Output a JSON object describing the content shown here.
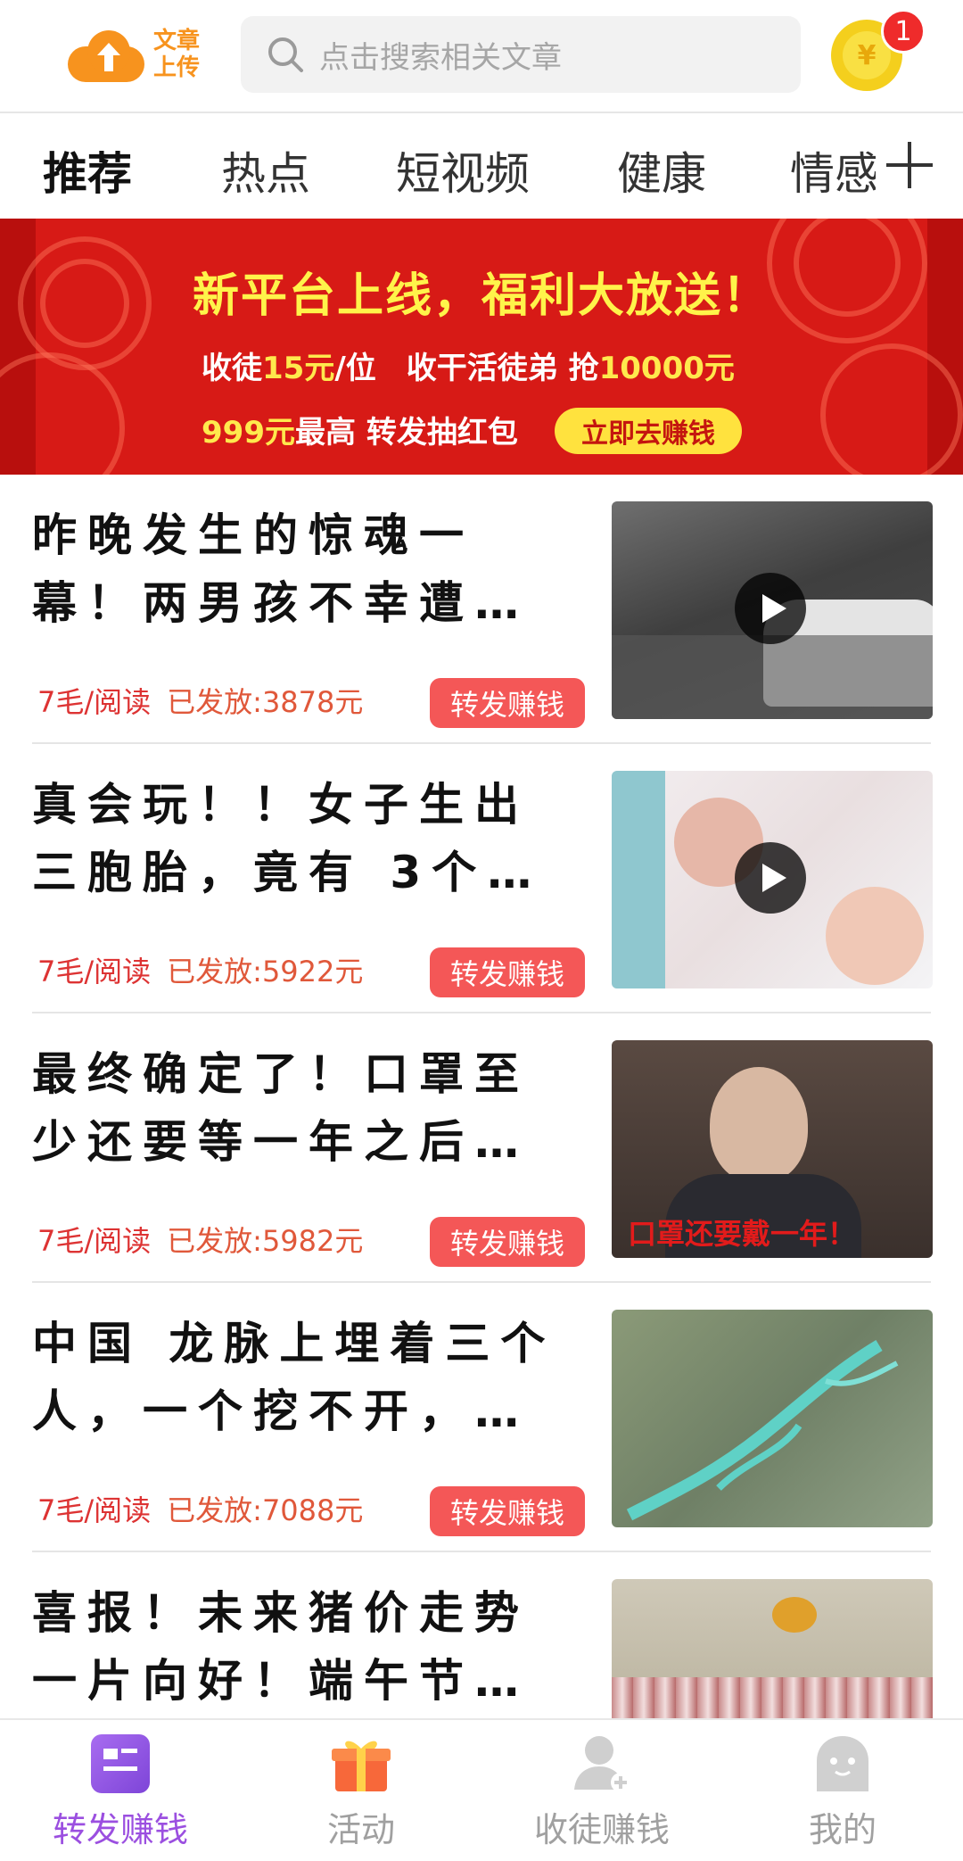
{
  "header": {
    "logo_line1": "文章",
    "logo_line2": "上传",
    "search_placeholder": "点击搜索相关文章",
    "coin_symbol": "¥",
    "badge_count": "1"
  },
  "tabs": [
    {
      "label": "推荐",
      "active": true
    },
    {
      "label": "热点",
      "active": false
    },
    {
      "label": "短视频",
      "active": false
    },
    {
      "label": "健康",
      "active": false
    },
    {
      "label": "情感",
      "active": false
    }
  ],
  "banner": {
    "title": "新平台上线，福利大放送！",
    "line2_a": "收徒",
    "line2_b": "15元",
    "line2_c": "/位　收干活徒弟 抢",
    "line2_d": "10000元",
    "line3_a": "999元",
    "line3_b": "最高 转发抽红包",
    "button": "立即去赚钱"
  },
  "feed": {
    "share_label": "转发赚钱",
    "items": [
      {
        "line1": "昨晚发生的惊魂一",
        "line2": "幕！两男孩不幸遭…",
        "rate": "7毛/阅读",
        "paid": "已发放:3878元",
        "video": true,
        "thumb": "night-street-car"
      },
      {
        "line1": "真会玩！！女子生出",
        "line2": "三胞胎，竟有 3个…",
        "rate": "7毛/阅读",
        "paid": "已发放:5922元",
        "video": true,
        "thumb": "newborn-babies"
      },
      {
        "line1": "最终确定了！口罩至",
        "line2": "少还要等一年之后…",
        "rate": "7毛/阅读",
        "paid": "已发放:5982元",
        "video": false,
        "thumb": "elderly-man-speaking",
        "thumb_caption": "口罩还要戴一年！"
      },
      {
        "line1": "中国 龙脉上埋着三个",
        "line2": "人，一个挖不开，…",
        "rate": "7毛/阅读",
        "paid": "已发放:7088元",
        "video": false,
        "thumb": "satellite-dragon-river"
      },
      {
        "line1": "喜报！未来猪价走势",
        "line2": "一片向好！端午节…",
        "rate": "",
        "paid": "",
        "video": false,
        "thumb": "pork-table"
      }
    ]
  },
  "bottom_nav": [
    {
      "label": "转发赚钱",
      "icon": "article-icon",
      "active": true
    },
    {
      "label": "活动",
      "icon": "gift-icon",
      "active": false
    },
    {
      "label": "收徒赚钱",
      "icon": "add-user-icon",
      "active": false
    },
    {
      "label": "我的",
      "icon": "profile-ghost-icon",
      "active": false
    }
  ],
  "colors": {
    "accent_purple": "#9b4fe0",
    "share_red": "#f45757",
    "banner_red": "#d71a16",
    "logo_orange": "#f7931e"
  }
}
